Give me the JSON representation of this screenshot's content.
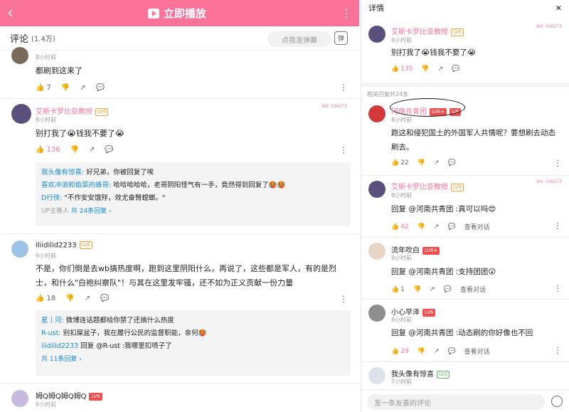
{
  "left": {
    "play_label": "立即播放",
    "comments_title": "评论",
    "comments_count": "(1.4万)",
    "danmu_placeholder": "点我发弹幕",
    "danmu_btn": "弹",
    "c1": {
      "time": "8小时前",
      "text": "都刷到这来了",
      "likes": "7"
    },
    "c2": {
      "name": "艾斯卡罗比亚教授",
      "level": "LV6",
      "time": "8小时前",
      "text": "别打我了😭钱我不要了😭",
      "likes": "136",
      "badge": "NO.\n036273",
      "replies": [
        {
          "name": "我头像有惊喜:",
          "text": " 好兄弟，你被回复了唉"
        },
        {
          "name": "喜欢冲浪和偷菜的蜂哥:",
          "text": " 哈哈哈哈哈，老哥阴阳怪气有一手，竟然得到回复了🥵🥵"
        },
        {
          "name": "D行侠:",
          "text": " \"不作安安饿殍，效尤奋臂螳螂。\""
        }
      ],
      "more": "UP主等人",
      "more2": "共 24条回复 ›"
    },
    "c3": {
      "name": "iliidilid2233",
      "level": "LV6",
      "time": "9小时前",
      "text": "不是，你们倒是去wb搞热度啊，跑到这里阴阳什么，再说了，这些都是军人，有的是烈士，和什么\"白袍纠察队\"！与其在这里发牢骚，还不如为正义贡献一份力量",
      "likes": "18",
      "replies": [
        {
          "name": "星丨河:",
          "text": " 微博连话题都给你禁了还搞什么热度"
        },
        {
          "name": "R-ust:",
          "text": " 别扣屎盆子，我在履行公民的监督职能，亲何🥵"
        },
        {
          "name": "iiidilid2233",
          "text": " 回复 @R-ust :我哪里扣喷子了",
          "at": "@R-ust"
        }
      ],
      "more2": "共 11条回复 ›"
    },
    "c4": {
      "name": "姆Q姆Q姆Q姆Q",
      "level": "LV6",
      "time": "9小时前"
    }
  },
  "right": {
    "title": "详情",
    "close": "✕",
    "main": {
      "name": "艾斯卡罗比亚教授",
      "level": "LV6",
      "time": "8小时前",
      "text": "别打我了😭钱我不要了😭",
      "likes": "135"
    },
    "related": "相关回复共24条",
    "replies": [
      {
        "name": "河南共青团",
        "level": "LV6+",
        "up": "UP",
        "time": "8小时前",
        "text": "跑这和侵犯国土的外国军人共情呢？要想刷去动态刷去。",
        "likes": "22"
      },
      {
        "name": "艾斯卡罗比亚教授",
        "level": "LV6",
        "time": "8小时前",
        "text": "回复 @河南共青团 :真可以吗😍",
        "likes": "42",
        "view": "查看对话"
      },
      {
        "name": "流年吹白",
        "level": "LV6+",
        "time": "8小时前",
        "text": "回复 @河南共青团 :支持团团😲",
        "likes": "1",
        "view": "查看对话"
      },
      {
        "name": "小心早泽",
        "level": "LV6",
        "time": "8小时前",
        "text": "回复 @河南共青团 :动态刷的你好像也不回",
        "likes": "29",
        "view": "查看对话"
      },
      {
        "name": "我头像有惊喜",
        "level": "LV5",
        "time": "7小时前"
      }
    ],
    "input_placeholder": "发一条友善的评论"
  },
  "colors": {
    "accent": "#fb7299",
    "link": "#178bcf"
  }
}
